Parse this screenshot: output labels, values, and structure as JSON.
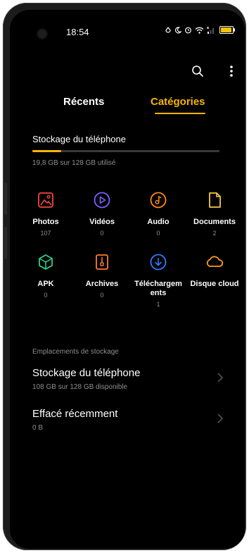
{
  "status_bar": {
    "time": "18:54"
  },
  "tabs": [
    {
      "label": "Récents",
      "selected": false
    },
    {
      "label": "Catégories",
      "selected": true
    }
  ],
  "storage_summary": {
    "title": "Stockage du téléphone",
    "usage_text": "19,8 GB sur 128 GB utilisé",
    "used_fraction": 0.155
  },
  "categories": [
    {
      "label": "Photos",
      "count": "107",
      "icon": "image-icon",
      "color": "#f0473d"
    },
    {
      "label": "Vidéos",
      "count": "0",
      "icon": "play-icon",
      "color": "#7b61ff"
    },
    {
      "label": "Audio",
      "count": "0",
      "icon": "music-note-icon",
      "color": "#ff8a1f"
    },
    {
      "label": "Documents",
      "count": "2",
      "icon": "document-icon",
      "color": "#f7c846"
    },
    {
      "label": "APK",
      "count": "0",
      "icon": "cube-icon",
      "color": "#2fcf8e"
    },
    {
      "label": "Archives",
      "count": "0",
      "icon": "archive-icon",
      "color": "#ff7a2e"
    },
    {
      "label": "Téléchargem ents",
      "count": "1",
      "icon": "download-icon",
      "color": "#2f7bff"
    },
    {
      "label": "Disque cloud",
      "count": "",
      "icon": "cloud-icon",
      "color": "#ff9c1f"
    }
  ],
  "locations": {
    "section_label": "Emplacements de stockage",
    "items": [
      {
        "title": "Stockage du téléphone",
        "subtitle": "108 GB sur 128 GB disponible"
      },
      {
        "title": "Effacé récemment",
        "subtitle": "0 B"
      }
    ]
  },
  "colors": {
    "accent": "#f7b500",
    "background": "#000000",
    "secondary_text": "#8e8e8e"
  }
}
